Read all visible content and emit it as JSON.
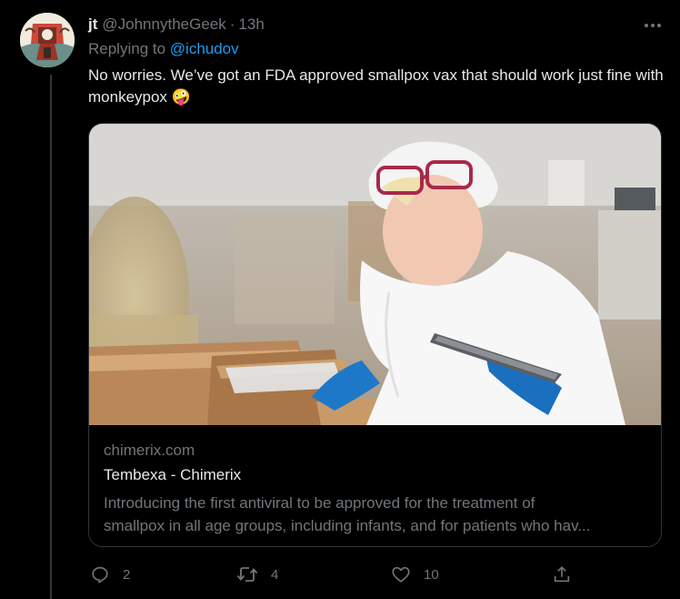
{
  "tweet": {
    "author_name": "jt",
    "author_handle": "@JohnnytheGeek",
    "separator": "·",
    "timestamp": "13h",
    "replying_prefix": "Replying to ",
    "replying_to": "@ichudov",
    "text": "No worries. We’ve got an FDA approved smallpox vax that should work just fine with monkeypox",
    "emoji": "🤪"
  },
  "card": {
    "domain": "chimerix.com",
    "title": "Tembexa - Chimerix",
    "description_lines": [
      "Introducing the first antiviral to be approved for the treatment of",
      "smallpox in all age groups, including infants, and for patients who hav..."
    ]
  },
  "actions": {
    "reply_count": "2",
    "retweet_count": "4",
    "like_count": "10"
  },
  "icons": {
    "more": "more-dots-icon",
    "reply": "reply-icon",
    "retweet": "retweet-icon",
    "like": "heart-icon",
    "share": "share-icon"
  },
  "colors": {
    "background": "#000000",
    "text": "#e7e9ea",
    "secondary": "#71767b",
    "link": "#1d9bf0",
    "border": "#2f3336"
  }
}
